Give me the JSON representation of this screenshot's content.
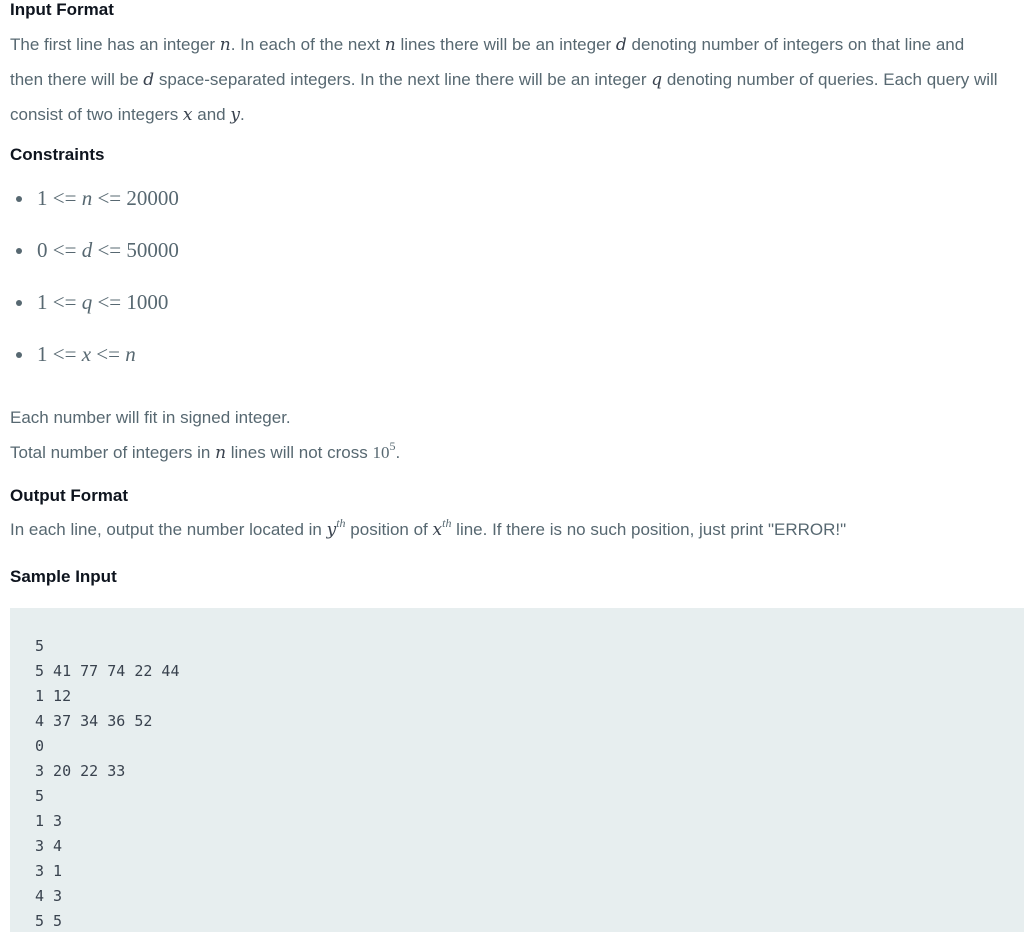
{
  "input_format": {
    "heading": "Input Format",
    "line1": {
      "t1": "The first line has an integer ",
      "v1": "n",
      "t2": ". In each of the next ",
      "v2": "n",
      "t3": " lines there will be an integer ",
      "v3": "d",
      "t4": " denoting number of integers on that line and"
    },
    "line2": {
      "t1": "then there will be ",
      "v1": "d",
      "t2": " space-separated integers. In the next line there will be an integer ",
      "v2": "q",
      "t3": " denoting number of queries. Each query will"
    },
    "line3": {
      "t1": "consist of two integers ",
      "v1": "x",
      "t2": " and ",
      "v2": "y",
      "t3": "."
    }
  },
  "constraints": {
    "heading": "Constraints",
    "items": [
      {
        "left": "1 <= ",
        "var": "n",
        "right": " <= 20000"
      },
      {
        "left": "0 <= ",
        "var": "d",
        "right": " <= 50000"
      },
      {
        "left": "1 <= ",
        "var": "q",
        "right": " <= 1000"
      },
      {
        "left": "1 <= ",
        "var": "x",
        "right": " <= ",
        "var2": "n"
      }
    ],
    "note1": "Each number will fit in signed integer.",
    "note2": {
      "t1": "Total number of integers in ",
      "v1": "n",
      "t2": " lines will not cross ",
      "base": "10",
      "exp": "5",
      "t3": "."
    }
  },
  "output_format": {
    "heading": "Output Format",
    "line": {
      "t1": "In each line, output the number located in ",
      "v1": "y",
      "s1": "th",
      "t2": " position of ",
      "v2": "x",
      "s2": "th",
      "t3": " line. If there is no such position, just print \"ERROR!\""
    }
  },
  "sample_input": {
    "heading": "Sample Input",
    "lines": [
      "5",
      "5 41 77 74 22 44",
      "1 12",
      "4 37 34 36 52",
      "0",
      "3 20 22 33",
      "5",
      "1 3",
      "3 4",
      "3 1",
      "4 3",
      "5 5"
    ]
  },
  "colors": {
    "heading": "#0e141e",
    "body_text": "#576871",
    "code_background": "#e7eeef"
  }
}
